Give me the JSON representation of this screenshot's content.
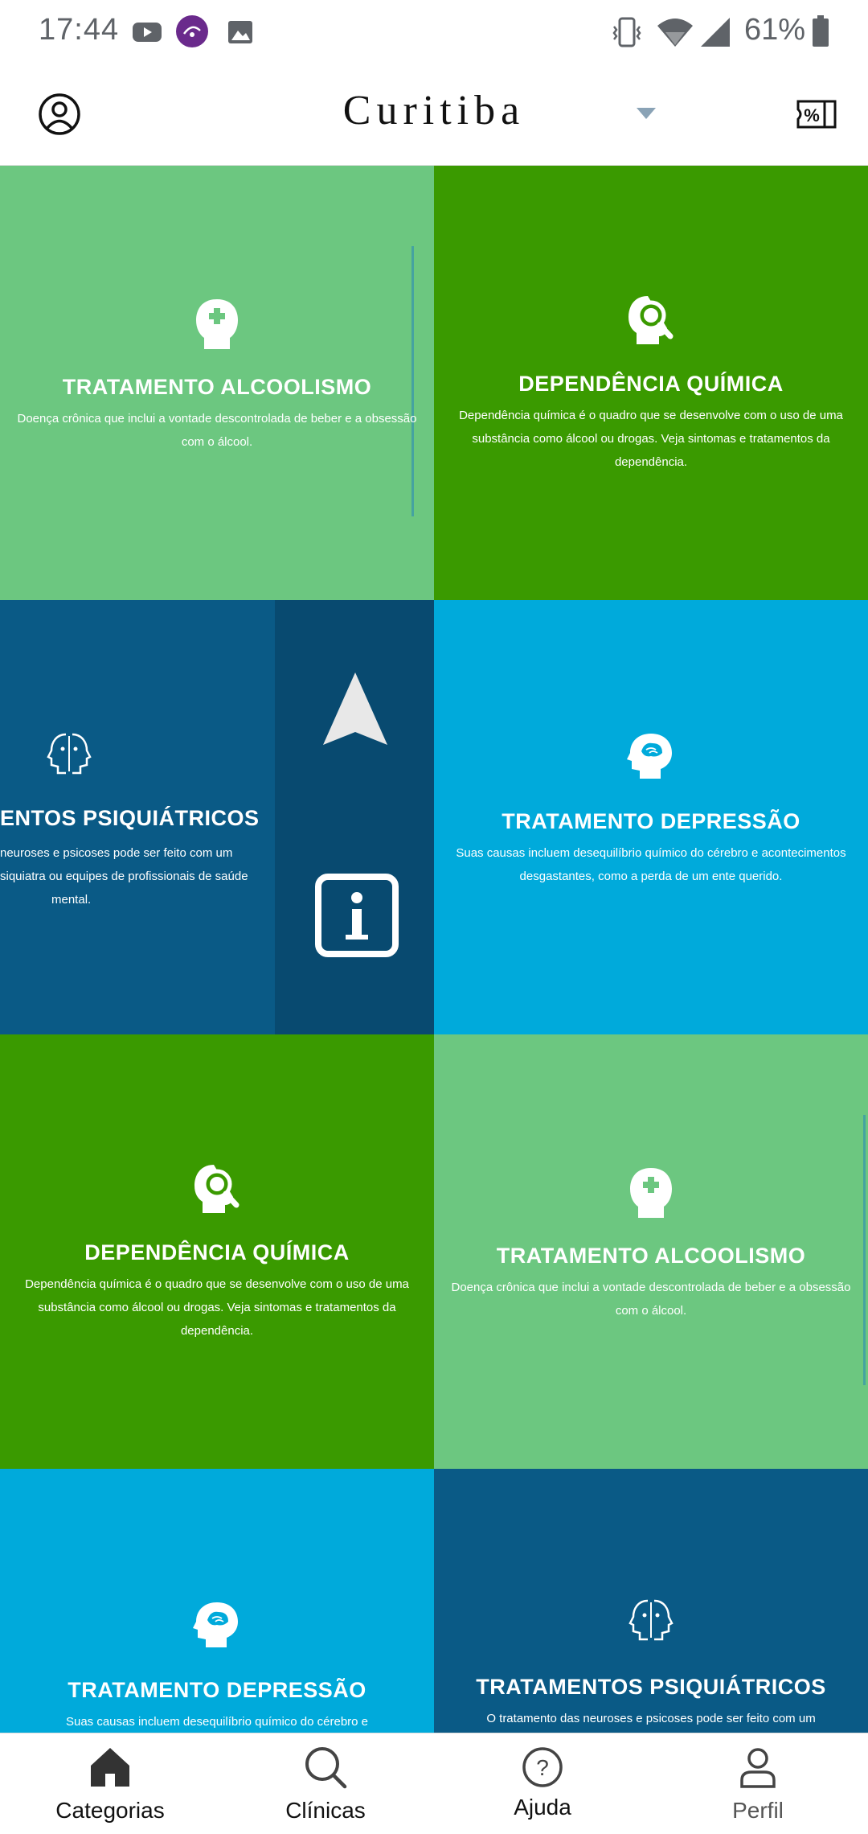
{
  "status_bar": {
    "time": "17:44",
    "battery": "61%",
    "icons": [
      "youtube-icon",
      "app-badge-icon",
      "gallery-icon",
      "vibrate-icon",
      "wifi-icon",
      "signal-icon",
      "battery-icon"
    ]
  },
  "header": {
    "city": "Curitiba",
    "icons": [
      "account-icon",
      "dropdown-arrow-icon",
      "coupon-icon"
    ]
  },
  "tiles": [
    {
      "title": "TRATAMENTO ALCOOLISMO",
      "desc": "Doença crônica que inclui a vontade descontrolada de beber e a obsessão com o álcool.",
      "icon": "head-cross-icon",
      "color": "#6cc780"
    },
    {
      "title": "DEPENDÊNCIA QUÍMICA",
      "desc": "Dependência química é o quadro que se desenvolve com o uso de uma substância como álcool ou drogas. Veja sintomas e tratamentos da dependência.",
      "icon": "head-magnifier-icon",
      "color": "#3a9a00"
    },
    {
      "title": "ENTOS PSIQUIÁTRICOS",
      "desc_lines": [
        "neuroses e psicoses pode ser feito com um",
        "siquiatra ou equipes de profissionais de saúde",
        "mental."
      ],
      "icon": "two-faces-icon",
      "color": "#0a5a86"
    },
    {
      "title": "TRATAMENTO DEPRESSÃO",
      "desc": "Suas causas incluem desequilíbrio químico do cérebro e acontecimentos desgastantes, como a perda de um ente querido.",
      "icon": "head-brain-icon",
      "color": "#00aadb"
    },
    {
      "title": "DEPENDÊNCIA QUÍMICA",
      "desc": "Dependência química é o quadro que se desenvolve com o uso de uma substância como álcool ou drogas. Veja sintomas e tratamentos da dependência.",
      "icon": "head-magnifier-icon",
      "color": "#3a9a00"
    },
    {
      "title": "TRATAMENTO ALCOOLISMO",
      "desc": "Doença crônica que inclui a vontade descontrolada de beber e a obsessão com o álcool.",
      "icon": "head-cross-icon",
      "color": "#6cc780"
    },
    {
      "title": "TRATAMENTO DEPRESSÃO",
      "desc": "Suas causas incluem desequilíbrio químico do cérebro e",
      "icon": "head-brain-icon",
      "color": "#00aadb"
    },
    {
      "title": "TRATAMENTOS PSIQUIÁTRICOS",
      "desc": "O tratamento das neuroses e psicoses pode ser feito com um",
      "icon": "two-faces-icon",
      "color": "#0a5a86"
    }
  ],
  "overlay": {
    "icons": [
      "navigation-arrow-icon",
      "info-icon"
    ]
  },
  "bottom_nav": [
    {
      "label": "Categorias",
      "icon": "home-icon"
    },
    {
      "label": "Clínicas",
      "icon": "search-icon"
    },
    {
      "label": "Ajuda",
      "icon": "help-icon"
    },
    {
      "label": "Perfil",
      "icon": "person-icon"
    }
  ]
}
